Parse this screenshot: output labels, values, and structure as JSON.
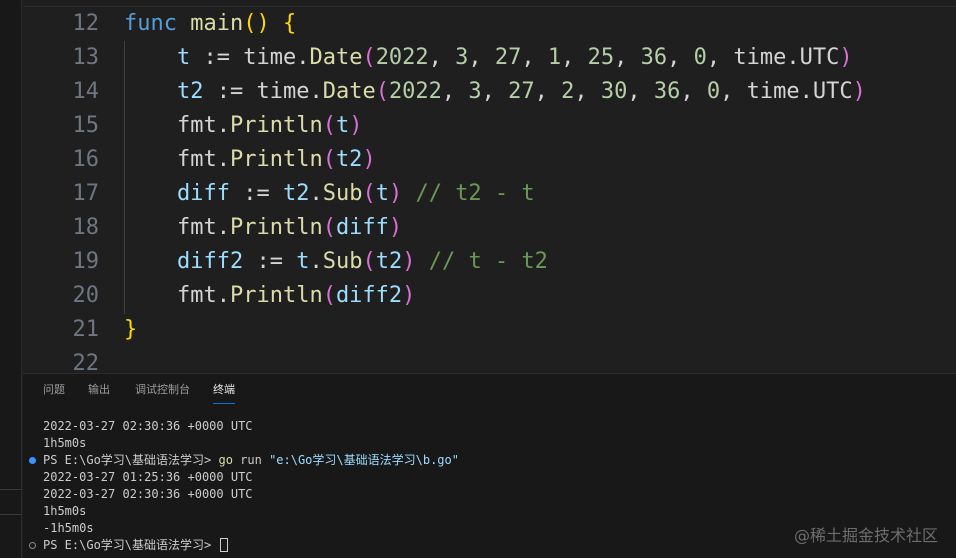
{
  "editor": {
    "lines": [
      {
        "n": "12",
        "tokens": [
          {
            "c": "kw",
            "t": "func"
          },
          {
            "c": "op",
            "t": " "
          },
          {
            "c": "fn",
            "t": "main"
          },
          {
            "c": "p1",
            "t": "()"
          },
          {
            "c": "op",
            "t": " "
          },
          {
            "c": "p1",
            "t": "{"
          }
        ]
      },
      {
        "n": "13",
        "tokens": [
          {
            "c": "op",
            "t": "    "
          },
          {
            "c": "var",
            "t": "t"
          },
          {
            "c": "op",
            "t": " := time."
          },
          {
            "c": "fn",
            "t": "Date"
          },
          {
            "c": "p2",
            "t": "("
          },
          {
            "c": "num",
            "t": "2022"
          },
          {
            "c": "op",
            "t": ", "
          },
          {
            "c": "num",
            "t": "3"
          },
          {
            "c": "op",
            "t": ", "
          },
          {
            "c": "num",
            "t": "27"
          },
          {
            "c": "op",
            "t": ", "
          },
          {
            "c": "num",
            "t": "1"
          },
          {
            "c": "op",
            "t": ", "
          },
          {
            "c": "num",
            "t": "25"
          },
          {
            "c": "op",
            "t": ", "
          },
          {
            "c": "num",
            "t": "36"
          },
          {
            "c": "op",
            "t": ", "
          },
          {
            "c": "num",
            "t": "0"
          },
          {
            "c": "op",
            "t": ", time.UTC"
          },
          {
            "c": "p2",
            "t": ")"
          }
        ]
      },
      {
        "n": "14",
        "tokens": [
          {
            "c": "op",
            "t": "    "
          },
          {
            "c": "var",
            "t": "t2"
          },
          {
            "c": "op",
            "t": " := time."
          },
          {
            "c": "fn",
            "t": "Date"
          },
          {
            "c": "p2",
            "t": "("
          },
          {
            "c": "num",
            "t": "2022"
          },
          {
            "c": "op",
            "t": ", "
          },
          {
            "c": "num",
            "t": "3"
          },
          {
            "c": "op",
            "t": ", "
          },
          {
            "c": "num",
            "t": "27"
          },
          {
            "c": "op",
            "t": ", "
          },
          {
            "c": "num",
            "t": "2"
          },
          {
            "c": "op",
            "t": ", "
          },
          {
            "c": "num",
            "t": "30"
          },
          {
            "c": "op",
            "t": ", "
          },
          {
            "c": "num",
            "t": "36"
          },
          {
            "c": "op",
            "t": ", "
          },
          {
            "c": "num",
            "t": "0"
          },
          {
            "c": "op",
            "t": ", time.UTC"
          },
          {
            "c": "p2",
            "t": ")"
          }
        ]
      },
      {
        "n": "15",
        "tokens": [
          {
            "c": "op",
            "t": "    fmt."
          },
          {
            "c": "fn",
            "t": "Println"
          },
          {
            "c": "p2",
            "t": "("
          },
          {
            "c": "var",
            "t": "t"
          },
          {
            "c": "p2",
            "t": ")"
          }
        ]
      },
      {
        "n": "16",
        "tokens": [
          {
            "c": "op",
            "t": "    fmt."
          },
          {
            "c": "fn",
            "t": "Println"
          },
          {
            "c": "p2",
            "t": "("
          },
          {
            "c": "var",
            "t": "t2"
          },
          {
            "c": "p2",
            "t": ")"
          }
        ]
      },
      {
        "n": "17",
        "tokens": [
          {
            "c": "op",
            "t": "    "
          },
          {
            "c": "var",
            "t": "diff"
          },
          {
            "c": "op",
            "t": " := "
          },
          {
            "c": "var",
            "t": "t2"
          },
          {
            "c": "op",
            "t": "."
          },
          {
            "c": "fn",
            "t": "Sub"
          },
          {
            "c": "p2",
            "t": "("
          },
          {
            "c": "var",
            "t": "t"
          },
          {
            "c": "p2",
            "t": ")"
          },
          {
            "c": "op",
            "t": " "
          },
          {
            "c": "cm",
            "t": "// t2 - t"
          }
        ]
      },
      {
        "n": "18",
        "tokens": [
          {
            "c": "op",
            "t": "    fmt."
          },
          {
            "c": "fn",
            "t": "Println"
          },
          {
            "c": "p2",
            "t": "("
          },
          {
            "c": "var",
            "t": "diff"
          },
          {
            "c": "p2",
            "t": ")"
          }
        ]
      },
      {
        "n": "19",
        "tokens": [
          {
            "c": "op",
            "t": "    "
          },
          {
            "c": "var",
            "t": "diff2"
          },
          {
            "c": "op",
            "t": " := "
          },
          {
            "c": "var",
            "t": "t"
          },
          {
            "c": "op",
            "t": "."
          },
          {
            "c": "fn",
            "t": "Sub"
          },
          {
            "c": "p2",
            "t": "("
          },
          {
            "c": "var",
            "t": "t2"
          },
          {
            "c": "p2",
            "t": ")"
          },
          {
            "c": "op",
            "t": " "
          },
          {
            "c": "cm",
            "t": "// t - t2"
          }
        ]
      },
      {
        "n": "20",
        "tokens": [
          {
            "c": "op",
            "t": "    fmt."
          },
          {
            "c": "fn",
            "t": "Println"
          },
          {
            "c": "p2",
            "t": "("
          },
          {
            "c": "var",
            "t": "diff2"
          },
          {
            "c": "p2",
            "t": ")"
          }
        ]
      },
      {
        "n": "21",
        "tokens": [
          {
            "c": "p1",
            "t": "}"
          }
        ]
      },
      {
        "n": "22",
        "tokens": []
      }
    ]
  },
  "panel": {
    "tabs": [
      {
        "label": "问题",
        "active": false
      },
      {
        "label": "输出",
        "active": false
      },
      {
        "label": "调试控制台",
        "active": false
      },
      {
        "label": "终端",
        "active": true
      }
    ],
    "terminal": {
      "line1": "2022-03-27 02:30:36 +0000 UTC",
      "line2": "1h5m0s",
      "prompt1": "PS E:\\Go学习\\基础语法学习> ",
      "cmd": "go",
      "cmd_args": " run ",
      "cmd_path": "\"e:\\Go学习\\基础语法学习\\b.go\"",
      "out1": "2022-03-27 01:25:36 +0000 UTC",
      "out2": "2022-03-27 02:30:36 +0000 UTC",
      "out3": "1h5m0s",
      "out4": "-1h5m0s",
      "prompt2": "PS E:\\Go学习\\基础语法学习> "
    }
  },
  "watermark": "@稀土掘金技术社区",
  "colors": {
    "editor_bg": "#1f1f1f",
    "panel_bg": "#181818",
    "keyword": "#569cd6",
    "function": "#dcdcaa",
    "variable": "#9cdcfe",
    "number": "#b5cea8",
    "comment": "#6a9955",
    "bracket1": "#ffd700",
    "bracket2": "#da70d6",
    "accent": "#0078d4"
  }
}
